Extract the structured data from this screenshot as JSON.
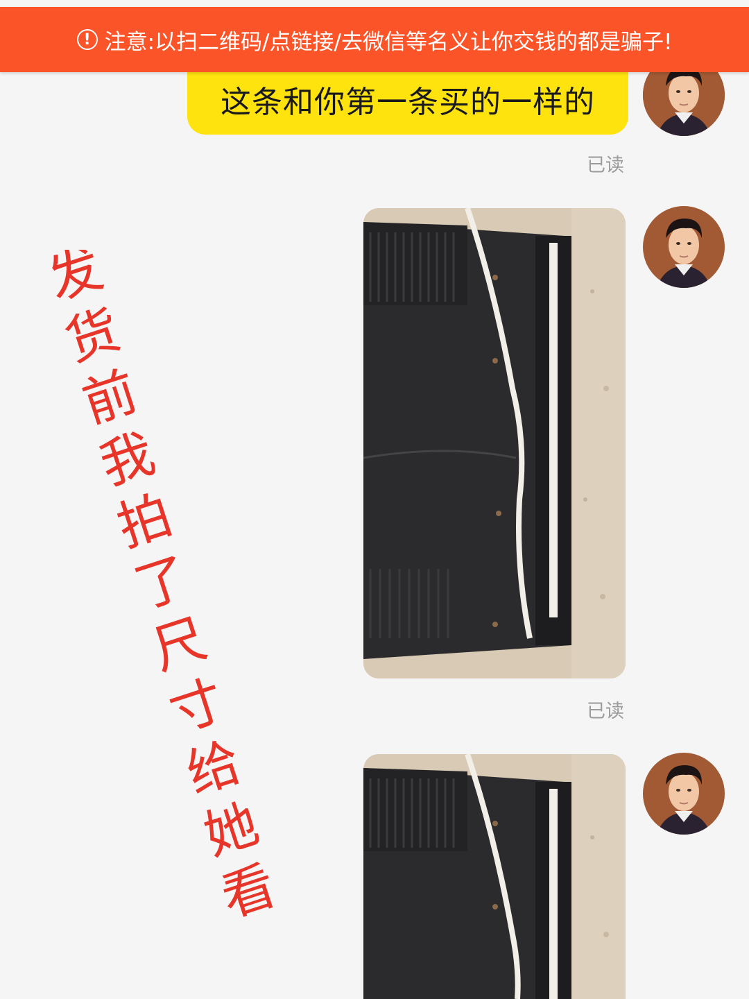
{
  "banner": {
    "icon": "warning-circle-icon",
    "text": "注意:以扫二维码/点链接/去微信等名义让你交钱的都是骗子!",
    "color": "#fa5428"
  },
  "messages": [
    {
      "type": "text",
      "text": "这条和你第一条买的一样的",
      "status": "已读"
    },
    {
      "type": "image",
      "image": "black-jeans-with-measuring-tape-photo",
      "status": "已读"
    },
    {
      "type": "image",
      "image": "black-jeans-with-measuring-tape-photo"
    }
  ],
  "overlay_caption": {
    "chars": [
      "发",
      "货",
      "前",
      "我",
      "拍",
      "了",
      "尺",
      "寸",
      "给",
      "她",
      "看"
    ],
    "color": "#e8352a"
  },
  "colors": {
    "bubble": "#ffe30f",
    "background": "#f5f5f5",
    "read_status": "#9b9b9b"
  }
}
